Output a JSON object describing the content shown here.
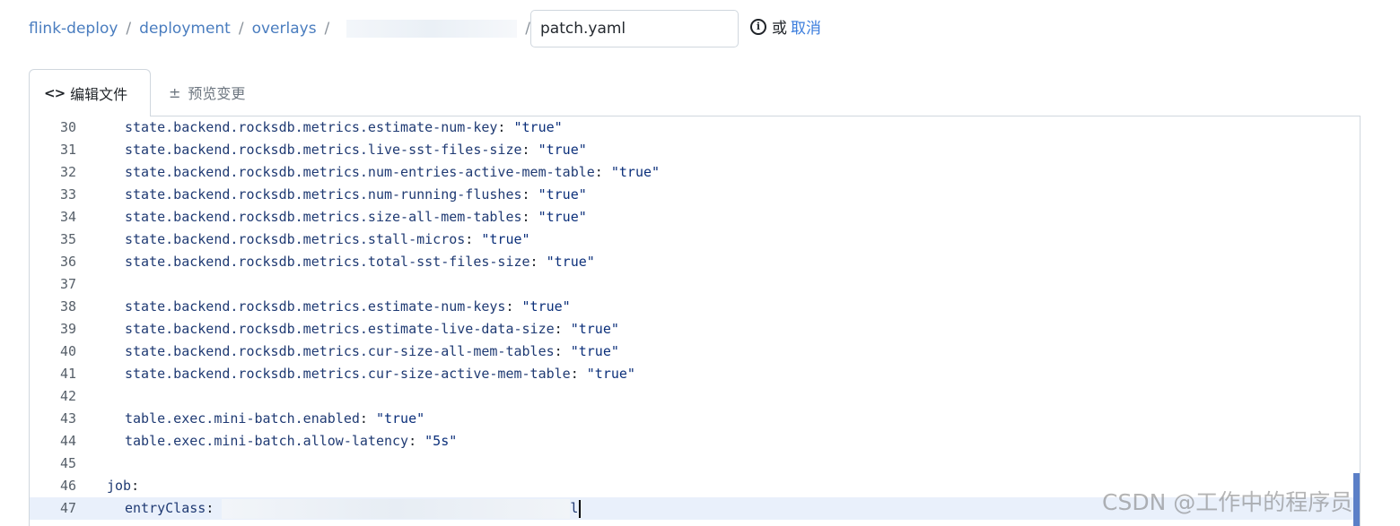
{
  "breadcrumb": {
    "items": [
      "flink-deploy",
      "deployment",
      "overlays"
    ],
    "separator": "/"
  },
  "filename": {
    "value": "patch.yaml"
  },
  "actions": {
    "or_text": "或",
    "cancel_label": "取消"
  },
  "tabs": [
    {
      "label": "编辑文件",
      "icon": "code-icon",
      "active": true
    },
    {
      "label": "预览变更",
      "icon": "diff-icon",
      "active": false
    }
  ],
  "editor": {
    "lines": [
      {
        "num": "30",
        "key": "state.backend.rocksdb.metrics.estimate-num-key",
        "value": "\"true\""
      },
      {
        "num": "31",
        "key": "state.backend.rocksdb.metrics.live-sst-files-size",
        "value": "\"true\""
      },
      {
        "num": "32",
        "key": "state.backend.rocksdb.metrics.num-entries-active-mem-table",
        "value": "\"true\""
      },
      {
        "num": "33",
        "key": "state.backend.rocksdb.metrics.num-running-flushes",
        "value": "\"true\""
      },
      {
        "num": "34",
        "key": "state.backend.rocksdb.metrics.size-all-mem-tables",
        "value": "\"true\""
      },
      {
        "num": "35",
        "key": "state.backend.rocksdb.metrics.stall-micros",
        "value": "\"true\""
      },
      {
        "num": "36",
        "key": "state.backend.rocksdb.metrics.total-sst-files-size",
        "value": "\"true\""
      },
      {
        "num": "37",
        "key": "",
        "value": ""
      },
      {
        "num": "38",
        "key": "state.backend.rocksdb.metrics.estimate-num-keys",
        "value": "\"true\""
      },
      {
        "num": "39",
        "key": "state.backend.rocksdb.metrics.estimate-live-data-size",
        "value": "\"true\""
      },
      {
        "num": "40",
        "key": "state.backend.rocksdb.metrics.cur-size-all-mem-tables",
        "value": "\"true\""
      },
      {
        "num": "41",
        "key": "state.backend.rocksdb.metrics.cur-size-active-mem-table",
        "value": "\"true\""
      },
      {
        "num": "42",
        "key": "",
        "value": ""
      },
      {
        "num": "43",
        "key": "table.exec.mini-batch.enabled",
        "value": "\"true\""
      },
      {
        "num": "44",
        "key": "table.exec.mini-batch.allow-latency",
        "value": "\"5s\""
      },
      {
        "num": "45",
        "key": "",
        "value": ""
      },
      {
        "num": "46",
        "key": "job",
        "value": "",
        "indent": 1
      },
      {
        "num": "47",
        "key": "entryClass",
        "value": "",
        "redacted": true,
        "trailing": "l",
        "active": true
      }
    ]
  },
  "watermark": "CSDN @工作中的程序员"
}
